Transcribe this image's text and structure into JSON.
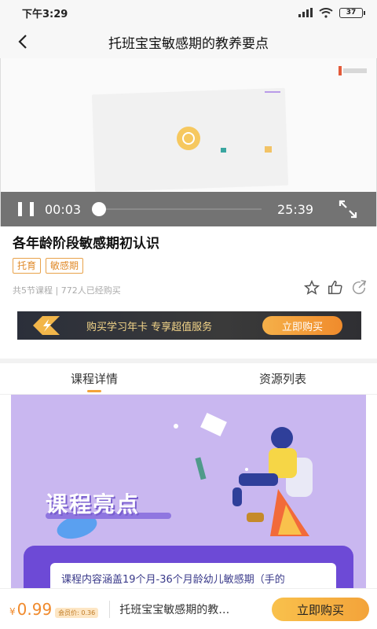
{
  "status_bar": {
    "time": "下午3:29",
    "battery": "37"
  },
  "nav": {
    "title": "托班宝宝敏感期的教养要点"
  },
  "player": {
    "current_time": "00:03",
    "total_time": "25:39",
    "progress": 0.002
  },
  "course": {
    "title": "各年龄阶段敏感期初认识",
    "tags": [
      "托育",
      "敏感期"
    ],
    "meta": "共5节课程 | 772人已经购买"
  },
  "vip_banner": {
    "text": "购买学习年卡 专享超值服务",
    "button": "立即购买"
  },
  "tabs": [
    {
      "label": "课程详情",
      "active": true
    },
    {
      "label": "资源列表",
      "active": false
    }
  ],
  "promo": {
    "heading": "课程亮点",
    "description": "课程内容涵盖19个月-36个月龄幼儿敏感期（手的"
  },
  "bottom_bar": {
    "currency": "¥",
    "price": "0.99",
    "member_price": "会员价: 0.36",
    "title": "托班宝宝敏感期的教…",
    "buy_button": "立即购买"
  },
  "colors": {
    "accent": "#f3a33a",
    "tag": "#e08a2a",
    "promo_bg": "#c9b7f0",
    "promo_purple": "#6d4ad6"
  },
  "icons": [
    "back-icon",
    "pause-icon",
    "fullscreen-icon",
    "star-icon",
    "thumb-up-icon",
    "share-icon",
    "lightning-icon",
    "signal-icon",
    "wifi-icon",
    "battery-icon"
  ]
}
